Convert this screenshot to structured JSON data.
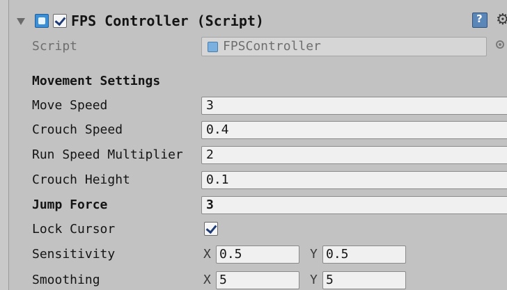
{
  "component": {
    "title": "FPS Controller (Script)",
    "enabled": true,
    "icons": {
      "foldout": "foldout-triangle-icon",
      "component": "script-icon",
      "help": "help-book-icon",
      "settings": "gear-icon"
    }
  },
  "script": {
    "label": "Script",
    "value": "FPSController"
  },
  "movement": {
    "section_title": "Movement Settings",
    "move_speed": {
      "label": "Move Speed",
      "value": "3"
    },
    "crouch_speed": {
      "label": "Crouch Speed",
      "value": "0.4"
    },
    "run_speed_multiplier": {
      "label": "Run Speed Multiplier",
      "value": "2"
    },
    "crouch_height": {
      "label": "Crouch Height",
      "value": "0.1"
    },
    "jump_force": {
      "label": "Jump Force",
      "value": "3"
    },
    "lock_cursor": {
      "label": "Lock Cursor",
      "checked": true
    }
  },
  "sensitivity": {
    "label": "Sensitivity",
    "x_label": "X",
    "x": "0.5",
    "y_label": "Y",
    "y": "0.5"
  },
  "smoothing": {
    "label": "Smoothing",
    "x_label": "X",
    "x": "5",
    "y_label": "Y",
    "y": "5"
  }
}
